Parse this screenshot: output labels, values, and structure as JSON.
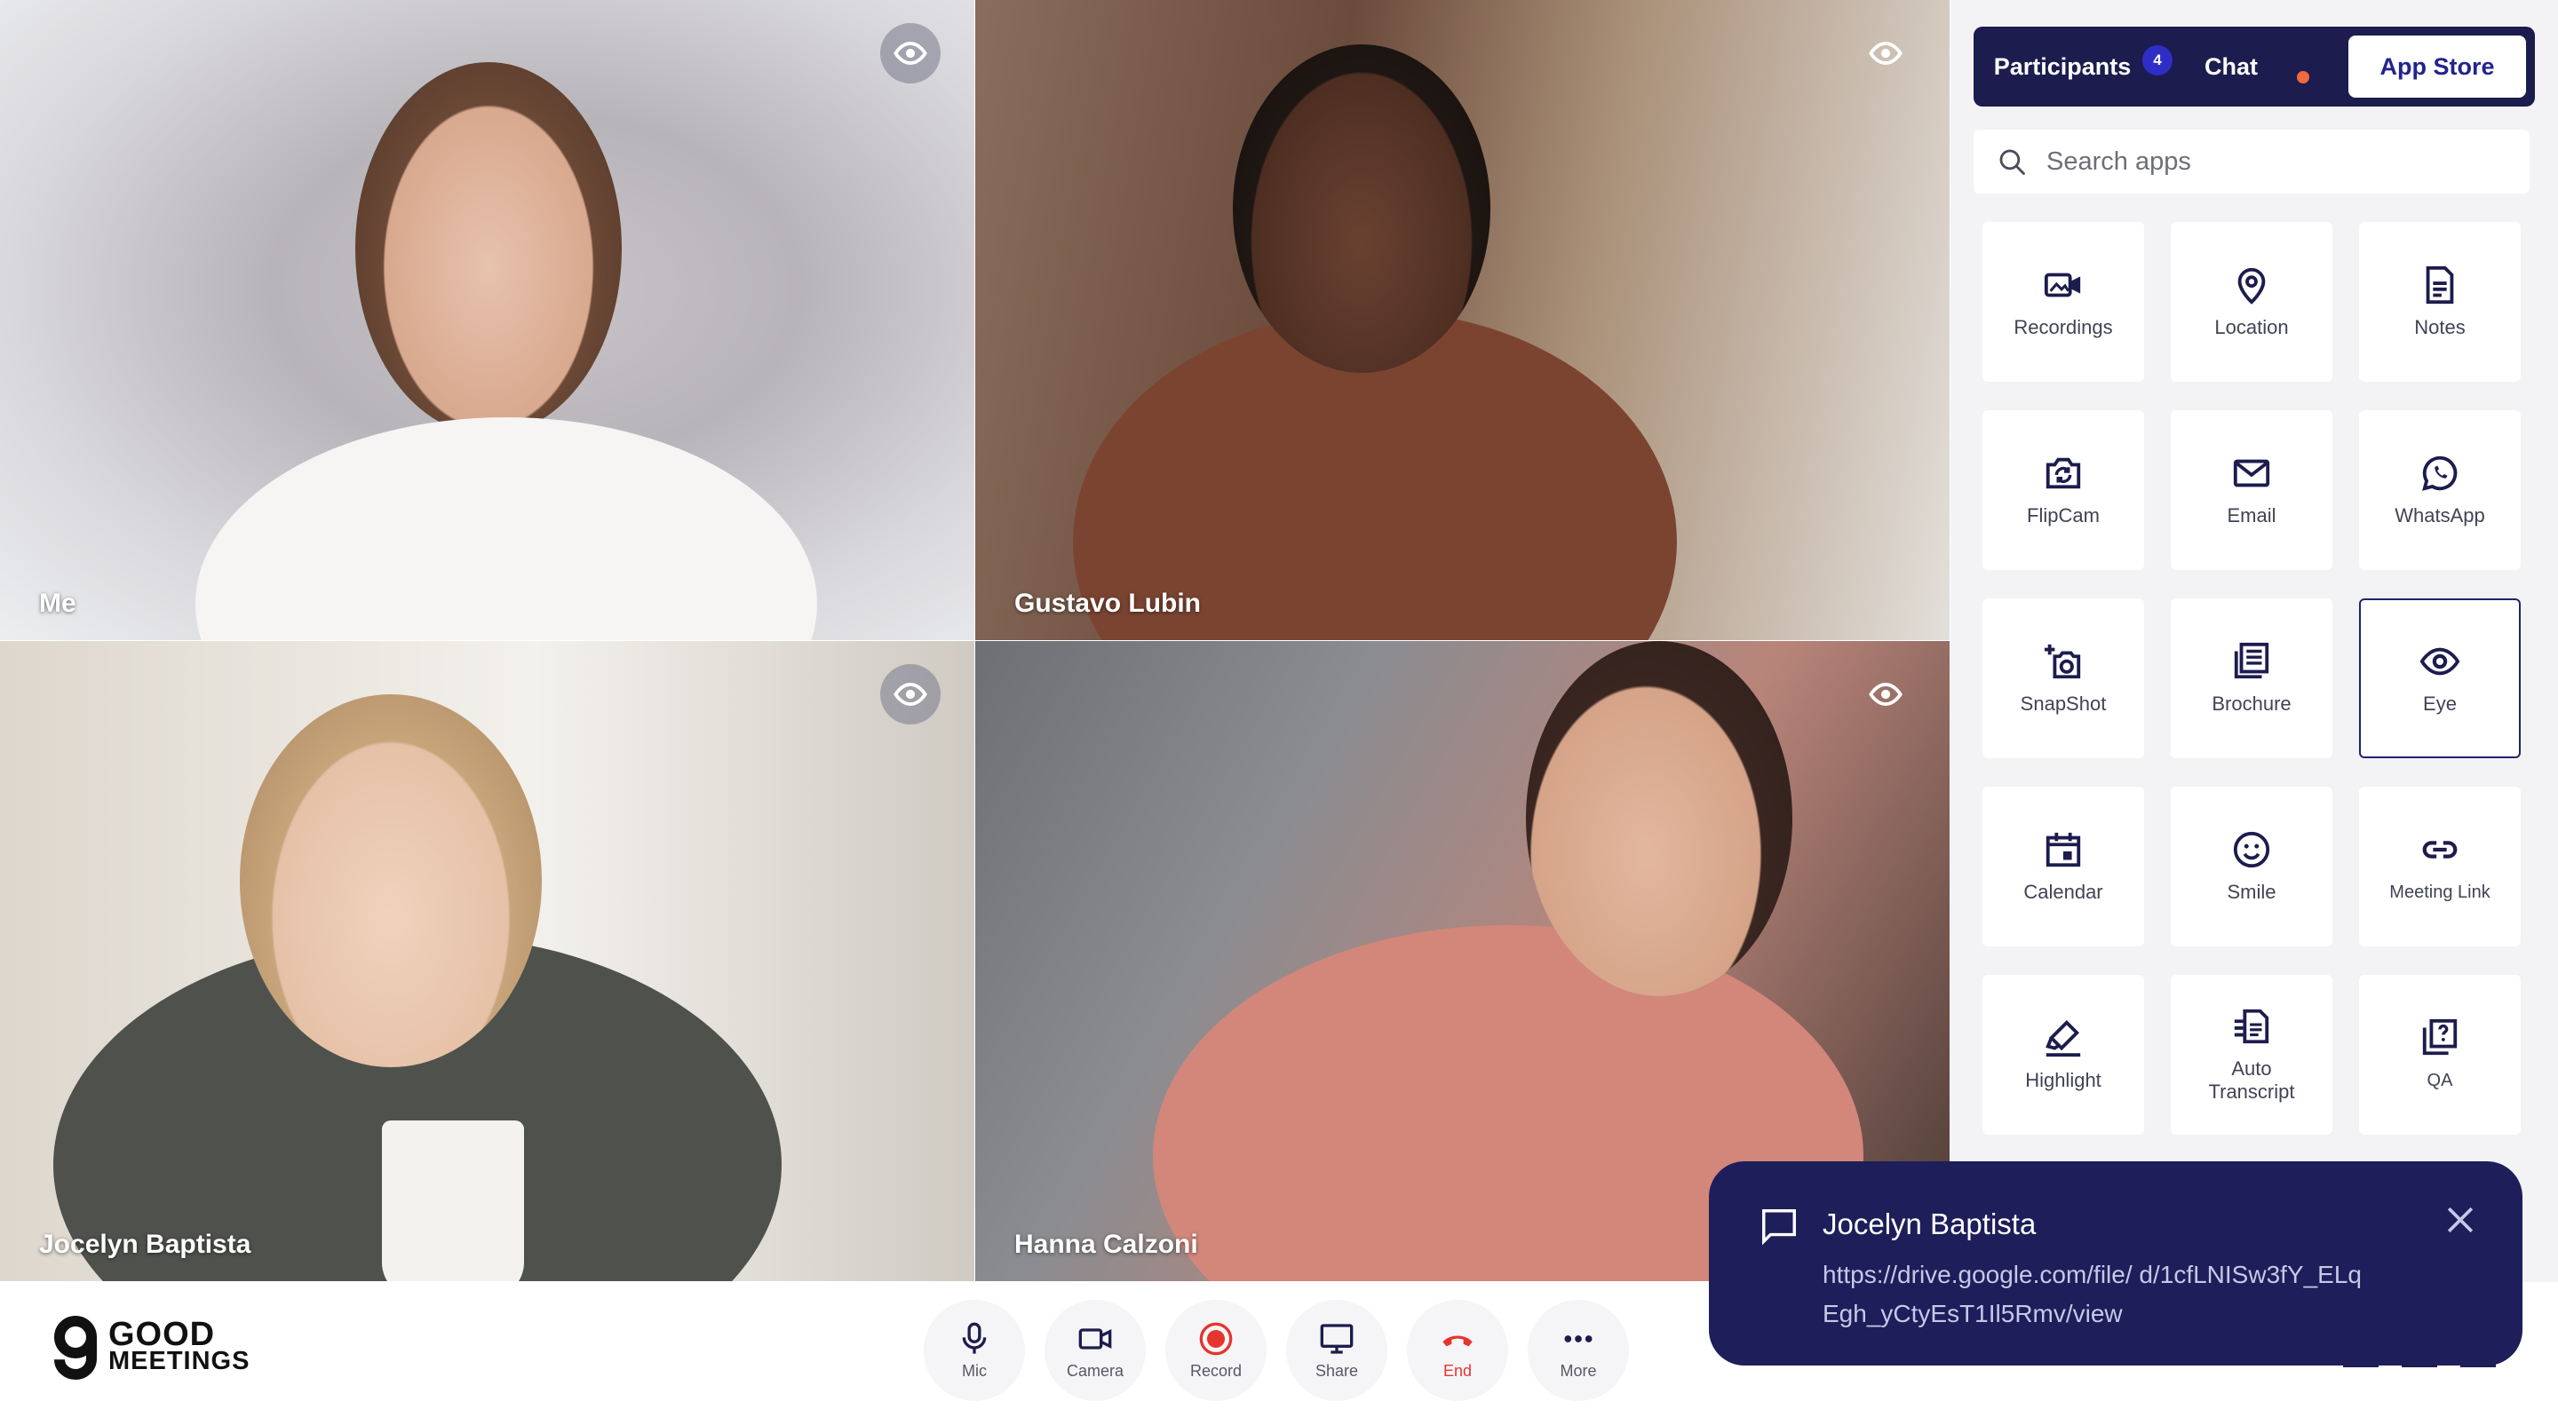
{
  "participants": [
    {
      "name": "Me"
    },
    {
      "name": "Gustavo Lubin"
    },
    {
      "name": "Jocelyn Baptista"
    },
    {
      "name": "Hanna Calzoni"
    }
  ],
  "panel": {
    "tabs": {
      "participants": "Participants",
      "participants_count": "4",
      "chat": "Chat",
      "app_store": "App Store"
    },
    "search_placeholder": "Search apps",
    "apps": [
      {
        "label": "Recordings",
        "icon": "video-icon"
      },
      {
        "label": "Location",
        "icon": "location-pin-icon"
      },
      {
        "label": "Notes",
        "icon": "notes-icon"
      },
      {
        "label": "FlipCam",
        "icon": "flip-camera-icon"
      },
      {
        "label": "Email",
        "icon": "email-icon"
      },
      {
        "label": "WhatsApp",
        "icon": "whatsapp-icon"
      },
      {
        "label": "SnapShot",
        "icon": "snapshot-icon"
      },
      {
        "label": "Brochure",
        "icon": "brochure-icon"
      },
      {
        "label": "Eye",
        "icon": "eye-icon",
        "selected": true
      },
      {
        "label": "Calendar",
        "icon": "calendar-icon"
      },
      {
        "label": "Smile",
        "icon": "smile-icon"
      },
      {
        "label": "Meeting Link",
        "icon": "link-icon"
      },
      {
        "label": "Highlight",
        "icon": "highlight-icon"
      },
      {
        "label": "Auto Transcript",
        "icon": "transcript-icon"
      },
      {
        "label": "QA",
        "icon": "qa-icon"
      }
    ]
  },
  "logo": {
    "line1": "GOOD",
    "line2": "MEETINGS"
  },
  "controls": [
    {
      "label": "Mic",
      "icon": "mic-icon"
    },
    {
      "label": "Camera",
      "icon": "camera-icon"
    },
    {
      "label": "Record",
      "icon": "record-icon"
    },
    {
      "label": "Share",
      "icon": "share-screen-icon"
    },
    {
      "label": "End",
      "icon": "end-call-icon"
    },
    {
      "label": "More",
      "icon": "more-icon"
    }
  ],
  "toast": {
    "sender": "Jocelyn Baptista",
    "message": "https://drive.google.com/file/ d/1cfLNISw3fY_ELqEgh_yCtyEsT1Il5Rmv/view"
  },
  "colors": {
    "navy": "#1c1c4e",
    "accent": "#23238f",
    "record_red": "#e5352e",
    "chat_dot": "#f06a3c"
  }
}
